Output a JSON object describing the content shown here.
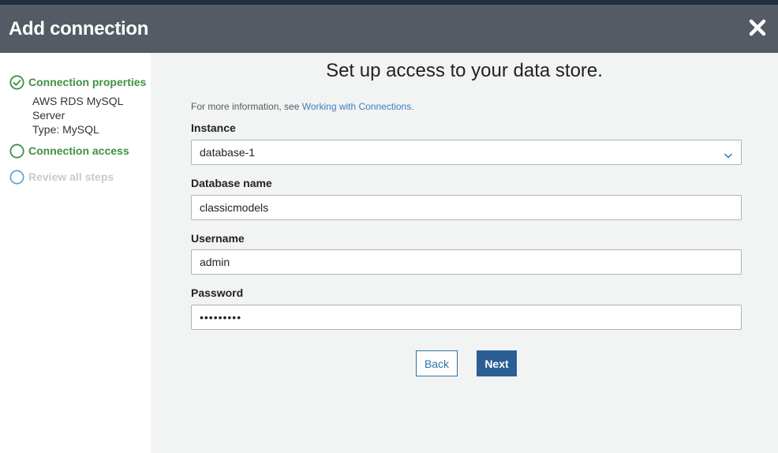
{
  "dialog": {
    "title": "Add connection",
    "close_icon": "close-icon"
  },
  "steps": [
    {
      "label": "Connection properties",
      "status": "complete",
      "icon": "check-circle-icon",
      "details": [
        "AWS RDS MySQL Server",
        "Type: MySQL"
      ]
    },
    {
      "label": "Connection access",
      "status": "current",
      "icon": "circle-icon"
    },
    {
      "label": "Review all steps",
      "status": "upcoming",
      "icon": "circle-icon"
    }
  ],
  "main": {
    "title": "Set up access to your data store.",
    "info_prefix": "For more information, see ",
    "info_link": "Working with Connections."
  },
  "form": {
    "instance": {
      "label": "Instance",
      "value": "database-1"
    },
    "database_name": {
      "label": "Database name",
      "value": "classicmodels"
    },
    "username": {
      "label": "Username",
      "value": "admin"
    },
    "password": {
      "label": "Password",
      "value": "•••••••••"
    }
  },
  "buttons": {
    "back": "Back",
    "next": "Next"
  },
  "colors": {
    "header_bg": "#545b64",
    "complete_green": "#3f9142",
    "upcoming_blue": "#5fa8d3",
    "primary_button": "#2b5f94",
    "link": "#3f7fbf"
  }
}
